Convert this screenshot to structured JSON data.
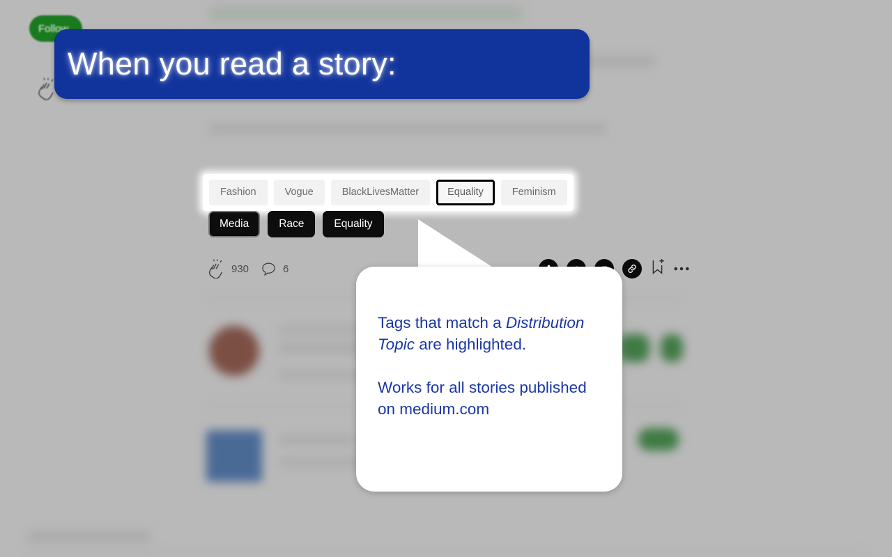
{
  "banner": {
    "headline": "When you read a story:"
  },
  "follow_button": {
    "label": "Follow"
  },
  "left_rail": {
    "clap_icon": "clap-icon"
  },
  "tags": {
    "matched_outline_color": "#000000",
    "items": [
      {
        "label": "Fashion",
        "matched": false
      },
      {
        "label": "Vogue",
        "matched": false
      },
      {
        "label": "BlackLivesMatter",
        "matched": false
      },
      {
        "label": "Equality",
        "matched": true
      },
      {
        "label": "Feminism",
        "matched": false
      }
    ]
  },
  "distribution_topics": {
    "items": [
      {
        "label": "Media",
        "focused": true
      },
      {
        "label": "Race",
        "focused": false
      },
      {
        "label": "Equality",
        "focused": false
      }
    ]
  },
  "engagement": {
    "clap_icon": "clap-icon",
    "clap_count": "930",
    "comment_icon": "comment-icon",
    "comment_count": "6"
  },
  "actions": {
    "share_icon": "share-icon",
    "link_icon": "link-icon",
    "bookmark_icon": "bookmark-add-icon",
    "more_icon": "more-horizontal-icon"
  },
  "callout": {
    "line1_a": "Tags that match a ",
    "line1_em": "Distribution Topic",
    "line1_b": " are highlighted.",
    "line2": "Works for all stories published on medium.com",
    "text_color": "#1b37a5"
  },
  "colors": {
    "page_background": "#b9b9b9",
    "banner_blue": "#11339c",
    "follow_green": "#1a7a1f",
    "topic_black": "#0d0d0d"
  }
}
